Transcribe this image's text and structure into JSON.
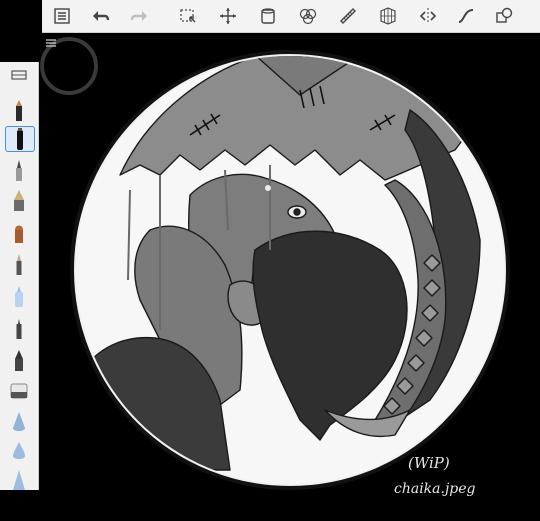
{
  "toolbar": {
    "items": [
      {
        "name": "lists-icon"
      },
      {
        "name": "undo-icon"
      },
      {
        "name": "redo-icon"
      },
      {
        "name": "selection-icon"
      },
      {
        "name": "transform-icon"
      },
      {
        "name": "fill-bucket-icon"
      },
      {
        "name": "color-icon"
      },
      {
        "name": "ruler-icon"
      },
      {
        "name": "perspective-grid-icon"
      },
      {
        "name": "symmetry-icon"
      },
      {
        "name": "steady-stroke-icon"
      },
      {
        "name": "shapes-icon"
      }
    ]
  },
  "palette": {
    "items": [
      {
        "name": "palette-menu-icon"
      },
      {
        "name": "pencil-icon"
      },
      {
        "name": "marker-icon",
        "selected": true
      },
      {
        "name": "brush-pen-icon"
      },
      {
        "name": "fountain-nib-icon"
      },
      {
        "name": "paint-brush-icon"
      },
      {
        "name": "fine-pencil-icon"
      },
      {
        "name": "airbrush-icon"
      },
      {
        "name": "ink-pen-icon"
      },
      {
        "name": "calligraphy-nib-icon"
      },
      {
        "name": "eraser-icon"
      },
      {
        "name": "smudge-icon"
      },
      {
        "name": "blur-drop-icon"
      },
      {
        "name": "paint-cone-icon"
      }
    ]
  },
  "artwork": {
    "note": "(WiP)",
    "signature": "chaika.jpeg"
  },
  "colors": {
    "toolbar_bg": "#f3f3f3",
    "canvas_bg": "#000000",
    "selected_accent": "#4a90e2"
  }
}
